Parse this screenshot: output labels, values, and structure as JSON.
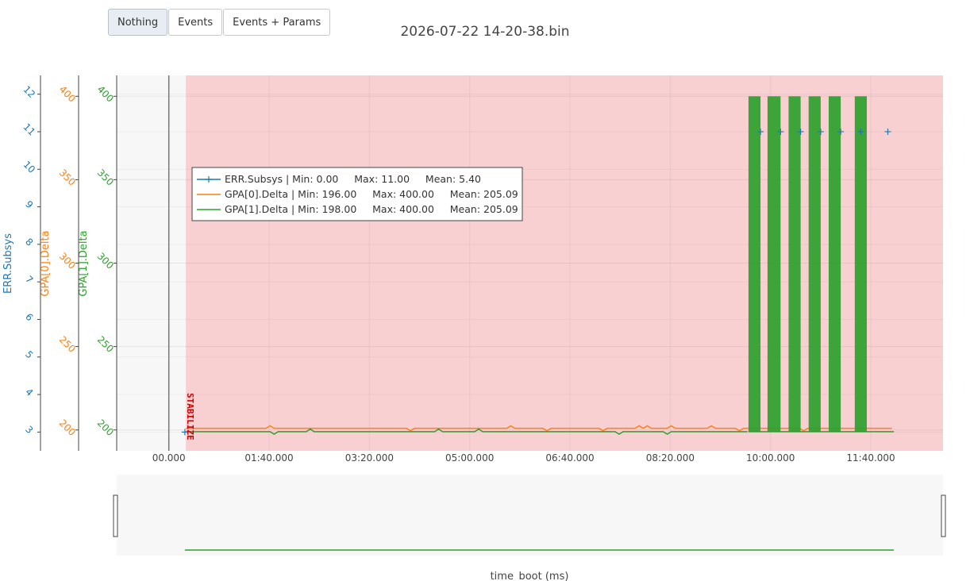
{
  "toolbar": {
    "buttons": [
      {
        "label": "Nothing",
        "active": true
      },
      {
        "label": "Events",
        "active": false
      },
      {
        "label": "Events + Params",
        "active": false
      }
    ]
  },
  "colors": {
    "err": "#1f77b4",
    "gpa0": "#ff7f0e",
    "gpa1": "#2ca02c",
    "shade": "#f8d0d2",
    "event": "#cc0000"
  },
  "chart_data": {
    "type": "line",
    "title": "2026-07-22 14-20-38.bin",
    "xlabel": "time_boot (ms)",
    "x_tick_labels": [
      "00.000",
      "01:40.000",
      "03:20.000",
      "05:00.000",
      "06:40.000",
      "08:20.000",
      "10:00.000",
      "11:40.000"
    ],
    "x_tick_values_s": [
      0,
      100,
      200,
      300,
      400,
      500,
      600,
      700
    ],
    "xlim_s": [
      -52,
      772
    ],
    "y_axes": [
      {
        "id": "err",
        "label": "ERR.Subsys",
        "range": [
          2.5,
          12.5
        ],
        "ticks": [
          "3",
          "4",
          "5",
          "6",
          "7",
          "8",
          "9",
          "10",
          "11",
          "12"
        ],
        "tick_values": [
          3,
          4,
          5,
          6,
          7,
          8,
          9,
          10,
          11,
          12
        ]
      },
      {
        "id": "gpa0",
        "label": "GPA[0].Delta",
        "range": [
          187.5,
          412.5
        ],
        "ticks": [
          "200",
          "250",
          "300",
          "350",
          "400"
        ],
        "tick_values": [
          200,
          250,
          300,
          350,
          400
        ]
      },
      {
        "id": "gpa1",
        "label": "GPA[1].Delta",
        "range": [
          187.5,
          412.5
        ],
        "ticks": [
          "200",
          "250",
          "300",
          "350",
          "400"
        ],
        "tick_values": [
          200,
          250,
          300,
          350,
          400
        ]
      }
    ],
    "event": {
      "label": "STABILIZE",
      "x_s": 17
    },
    "shaded_region_s": [
      17,
      772
    ],
    "series": [
      {
        "name": "ERR.Subsys",
        "axis": "err",
        "stats": "ERR.Subsys | Min: 0.00     Max: 11.00     Mean: 5.40",
        "points": [
          [
            16,
            3
          ],
          [
            590,
            11
          ],
          [
            610,
            11
          ],
          [
            630,
            11
          ],
          [
            650,
            11
          ],
          [
            670,
            11
          ],
          [
            690,
            11
          ],
          [
            717,
            11
          ]
        ]
      },
      {
        "name": "GPA[0].Delta",
        "axis": "gpa0",
        "stats": "GPA[0].Delta | Min: 196.00     Max: 400.00     Mean: 205.09",
        "baseline": 201,
        "x_range": [
          17,
          723
        ]
      },
      {
        "name": "GPA[1].Delta",
        "axis": "gpa1",
        "stats": "GPA[1].Delta | Min: 198.00     Max: 400.00     Mean: 205.09",
        "baseline": 199,
        "x_range": [
          17,
          723
        ],
        "spikes": [
          [
            578,
            590
          ],
          [
            597,
            610
          ],
          [
            618,
            630
          ],
          [
            638,
            650
          ],
          [
            658,
            670
          ],
          [
            684,
            696
          ]
        ],
        "spike_value": 400
      }
    ]
  }
}
